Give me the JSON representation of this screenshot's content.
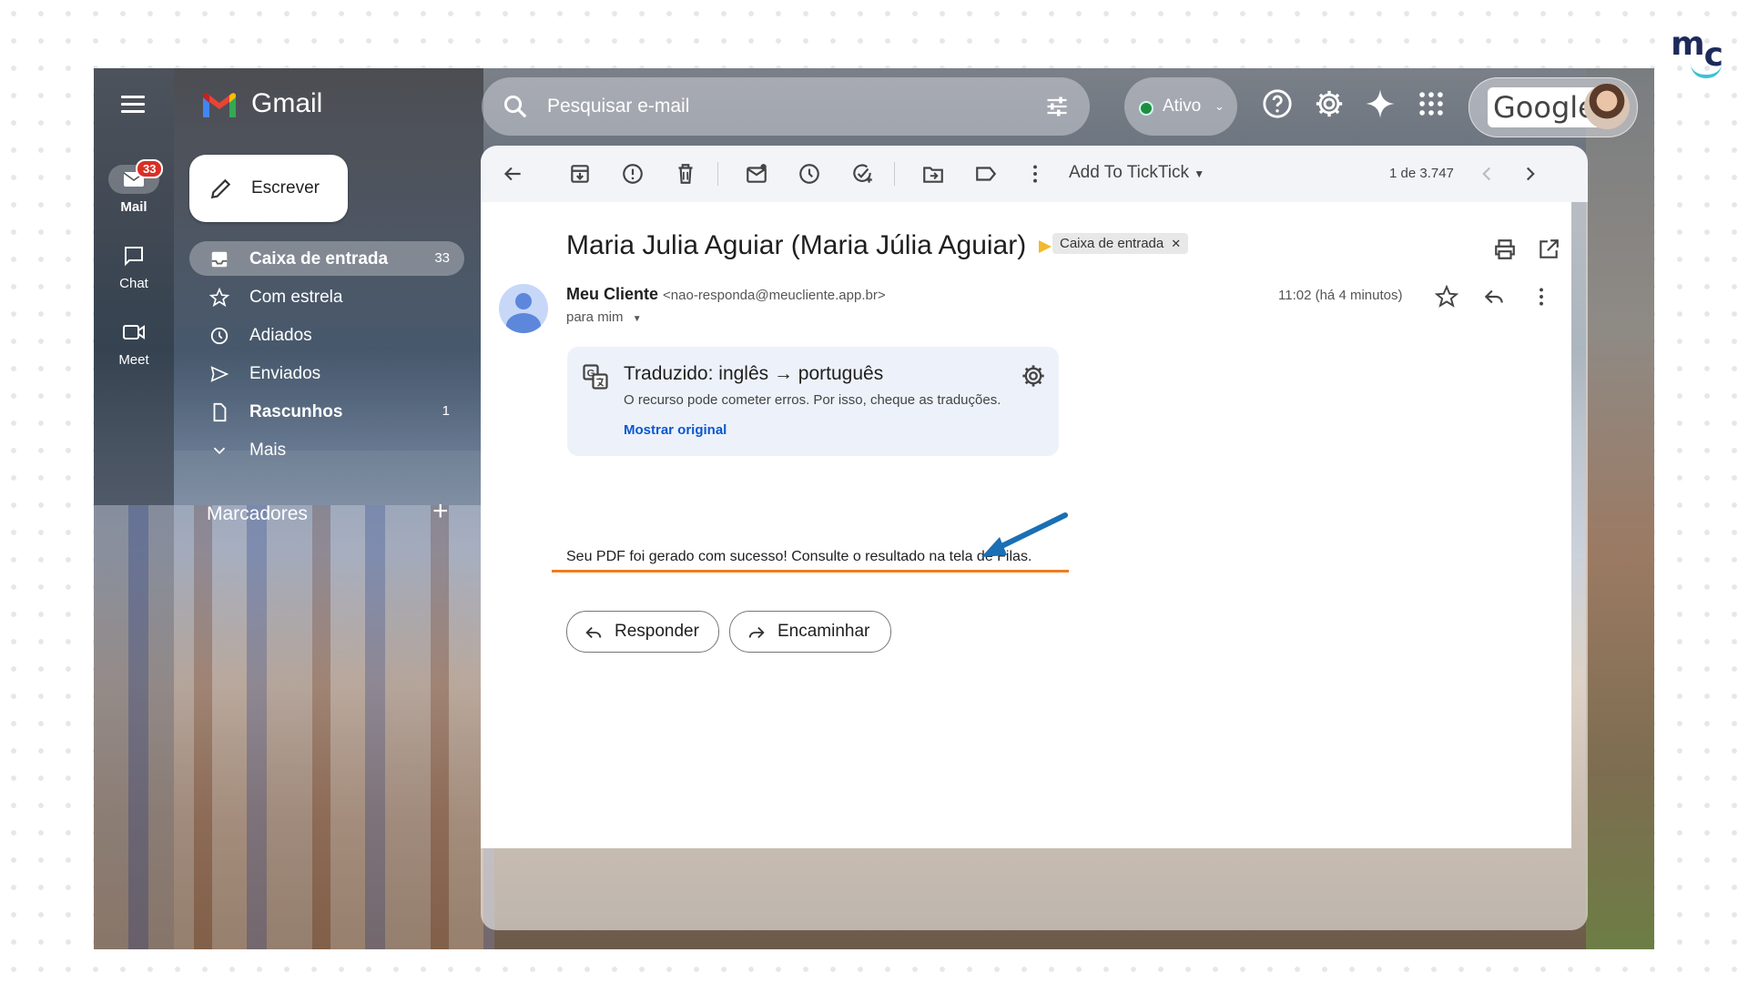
{
  "brand": {
    "logo_text_m": "m",
    "logo_text_c": "c"
  },
  "header": {
    "app_title": "Gmail",
    "search_placeholder": "Pesquisar e-mail",
    "status_label": "Ativo",
    "google_label": "Google"
  },
  "rail": [
    {
      "label": "Mail",
      "badge": "33"
    },
    {
      "label": "Chat"
    },
    {
      "label": "Meet"
    }
  ],
  "compose_label": "Escrever",
  "nav": [
    {
      "label": "Caixa de entrada",
      "count": "33"
    },
    {
      "label": "Com estrela",
      "count": ""
    },
    {
      "label": "Adiados",
      "count": ""
    },
    {
      "label": "Enviados",
      "count": ""
    },
    {
      "label": "Rascunhos",
      "count": "1"
    },
    {
      "label": "Mais",
      "count": ""
    }
  ],
  "labels_heading": "Marcadores",
  "toolbar": {
    "ticktick_label": "Add To TickTick",
    "pager": "1 de 3.747"
  },
  "message": {
    "subject": "Maria Julia Aguiar (Maria Júlia Aguiar)",
    "chip": "Caixa de entrada",
    "sender_name": "Meu Cliente",
    "sender_addr": "<nao-responda@meucliente.app.br>",
    "to": "para mim",
    "time": "11:02 (há 4 minutos)",
    "translation_title": "Traduzido: inglês → português",
    "translation_note": "O recurso pode cometer erros. Por isso, cheque as traduções.",
    "show_original": "Mostrar original",
    "body": "Seu PDF foi gerado com sucesso! Consulte o resultado na tela de Filas.",
    "reply_label": "Responder",
    "forward_label": "Encaminhar"
  },
  "colors": {
    "accent_underline": "#f07c1c",
    "annotation_arrow": "#1a6fb5",
    "badge": "#d93025",
    "link": "#0b57d0"
  }
}
